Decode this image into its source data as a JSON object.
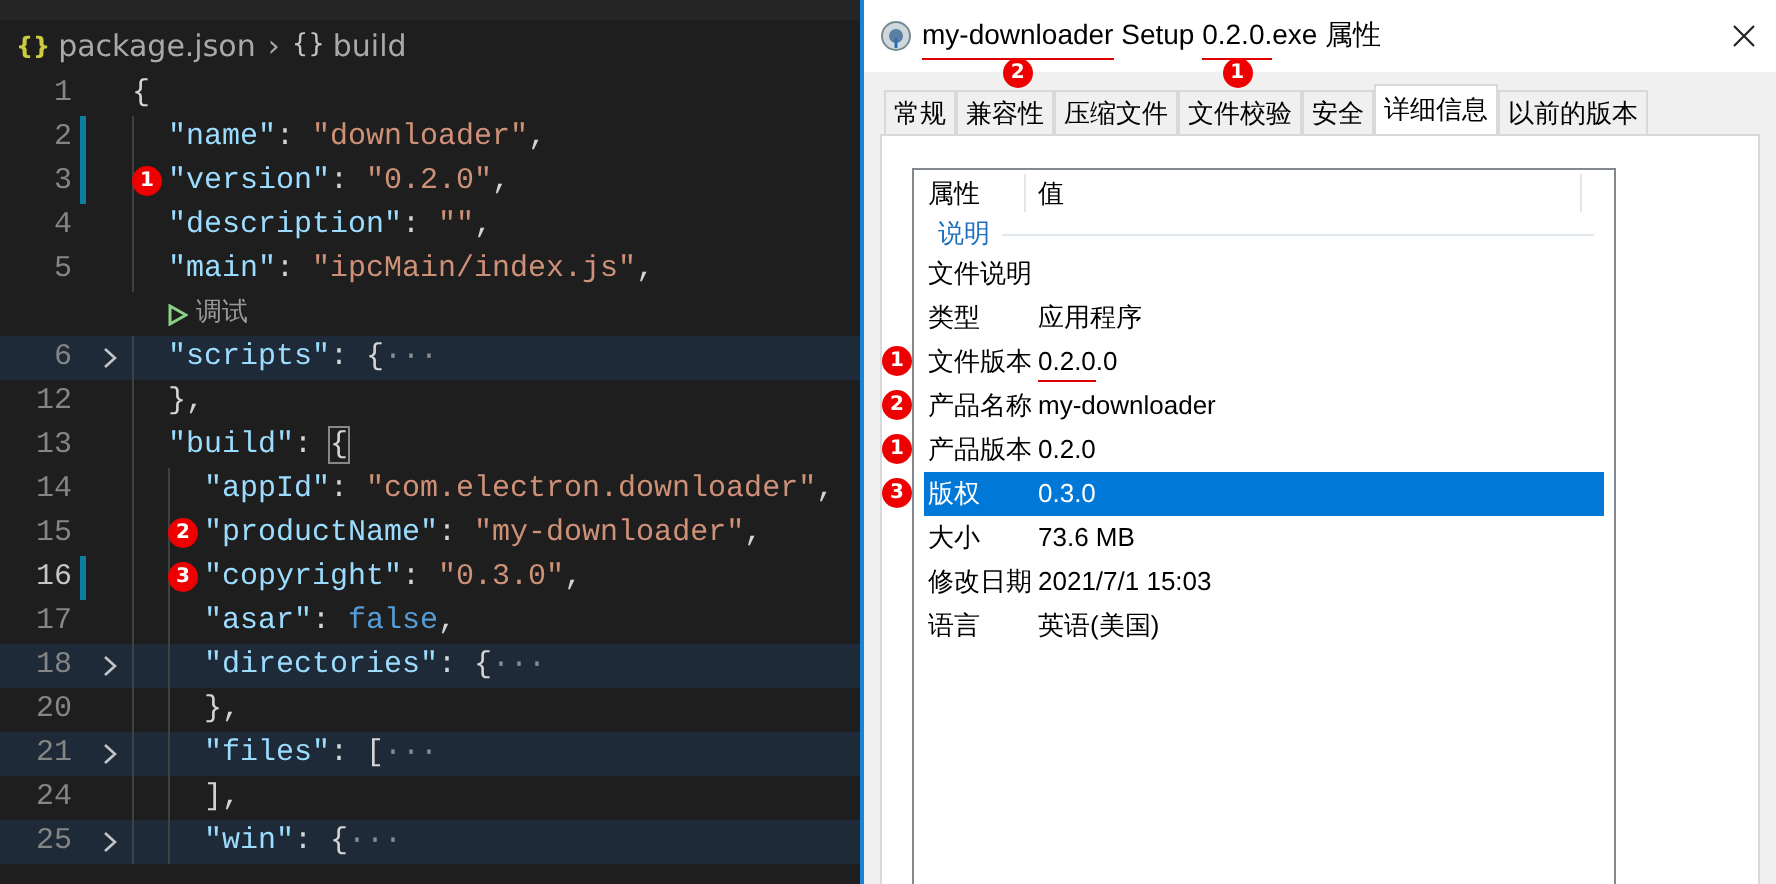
{
  "editor": {
    "breadcrumb": [
      {
        "kind": "file",
        "icon": "{}",
        "label": "package.json"
      },
      {
        "kind": "object",
        "separator": "›",
        "icon": "{}",
        "label": "build"
      }
    ],
    "lines": [
      {
        "kind": "code",
        "number": "1",
        "folded": false,
        "modified": false,
        "current": false,
        "tokens": [
          {
            "kind": "punc",
            "text": "{"
          }
        ],
        "children": [
          {
            "kind": "code",
            "number": "2",
            "folded": false,
            "modified": true,
            "current": false,
            "tokens": [
              {
                "kind": "key",
                "text": "\"name\""
              },
              {
                "kind": "punc",
                "text": ": "
              },
              {
                "kind": "str",
                "text": "\"downloader\""
              },
              {
                "kind": "punc",
                "text": ","
              }
            ]
          },
          {
            "kind": "code",
            "number": "3",
            "folded": false,
            "modified": true,
            "current": false,
            "badge": "1",
            "tokens": [
              {
                "kind": "key",
                "text": "\"version\""
              },
              {
                "kind": "punc",
                "text": ": "
              },
              {
                "kind": "str",
                "text": "\"0.2.0\""
              },
              {
                "kind": "punc",
                "text": ","
              }
            ]
          },
          {
            "kind": "code",
            "number": "4",
            "folded": false,
            "modified": false,
            "current": false,
            "tokens": [
              {
                "kind": "key",
                "text": "\"description\""
              },
              {
                "kind": "punc",
                "text": ": "
              },
              {
                "kind": "str",
                "text": "\"\""
              },
              {
                "kind": "punc",
                "text": ","
              }
            ]
          },
          {
            "kind": "code",
            "number": "5",
            "folded": false,
            "modified": false,
            "current": false,
            "tokens": [
              {
                "kind": "key",
                "text": "\"main\""
              },
              {
                "kind": "punc",
                "text": ": "
              },
              {
                "kind": "str",
                "text": "\"ipcMain/index.js\""
              },
              {
                "kind": "punc",
                "text": ","
              }
            ]
          },
          {
            "kind": "lens",
            "label": "调试"
          },
          {
            "kind": "code",
            "number": "6",
            "folded": true,
            "modified": false,
            "current": false,
            "tokens": [
              {
                "kind": "key",
                "text": "\"scripts\""
              },
              {
                "kind": "punc",
                "text": ": {"
              },
              {
                "kind": "fold",
                "text": "···"
              }
            ]
          },
          {
            "kind": "code",
            "number": "12",
            "folded": false,
            "modified": false,
            "current": false,
            "tokens": [
              {
                "kind": "punc",
                "text": "},"
              }
            ]
          },
          {
            "kind": "code",
            "number": "13",
            "folded": false,
            "modified": false,
            "current": false,
            "tokens": [
              {
                "kind": "key",
                "text": "\"build\""
              },
              {
                "kind": "punc",
                "text": ": "
              },
              {
                "kind": "bracket",
                "text": "{"
              }
            ],
            "children": [
              {
                "kind": "code",
                "number": "14",
                "folded": false,
                "modified": false,
                "current": false,
                "tokens": [
                  {
                    "kind": "key",
                    "text": "\"appId\""
                  },
                  {
                    "kind": "punc",
                    "text": ": "
                  },
                  {
                    "kind": "str",
                    "text": "\"com.electron.downloader\""
                  },
                  {
                    "kind": "punc",
                    "text": ","
                  }
                ]
              },
              {
                "kind": "code",
                "number": "15",
                "folded": false,
                "modified": false,
                "current": false,
                "badge": "2",
                "tokens": [
                  {
                    "kind": "key",
                    "text": "\"productName\""
                  },
                  {
                    "kind": "punc",
                    "text": ": "
                  },
                  {
                    "kind": "str",
                    "text": "\"my-downloader\""
                  },
                  {
                    "kind": "punc",
                    "text": ","
                  }
                ]
              },
              {
                "kind": "code",
                "number": "16",
                "folded": false,
                "modified": true,
                "current": true,
                "badge": "3",
                "tokens": [
                  {
                    "kind": "key",
                    "text": "\"copyright\""
                  },
                  {
                    "kind": "punc",
                    "text": ": "
                  },
                  {
                    "kind": "str",
                    "text": "\"0.3.0\""
                  },
                  {
                    "kind": "punc",
                    "text": ","
                  }
                ]
              },
              {
                "kind": "code",
                "number": "17",
                "folded": false,
                "modified": false,
                "current": false,
                "tokens": [
                  {
                    "kind": "key",
                    "text": "\"asar\""
                  },
                  {
                    "kind": "punc",
                    "text": ": "
                  },
                  {
                    "kind": "kw",
                    "text": "false"
                  },
                  {
                    "kind": "punc",
                    "text": ","
                  }
                ]
              },
              {
                "kind": "code",
                "number": "18",
                "folded": true,
                "modified": false,
                "current": false,
                "tokens": [
                  {
                    "kind": "key",
                    "text": "\"directories\""
                  },
                  {
                    "kind": "punc",
                    "text": ": {"
                  },
                  {
                    "kind": "fold",
                    "text": "···"
                  }
                ]
              },
              {
                "kind": "code",
                "number": "20",
                "folded": false,
                "modified": false,
                "current": false,
                "tokens": [
                  {
                    "kind": "punc",
                    "text": "},"
                  }
                ]
              },
              {
                "kind": "code",
                "number": "21",
                "folded": true,
                "modified": false,
                "current": false,
                "tokens": [
                  {
                    "kind": "key",
                    "text": "\"files\""
                  },
                  {
                    "kind": "punc",
                    "text": ": ["
                  },
                  {
                    "kind": "fold",
                    "text": "···"
                  }
                ]
              },
              {
                "kind": "code",
                "number": "24",
                "folded": false,
                "modified": false,
                "current": false,
                "tokens": [
                  {
                    "kind": "punc",
                    "text": "],"
                  }
                ]
              },
              {
                "kind": "code",
                "number": "25",
                "folded": true,
                "modified": false,
                "current": false,
                "tokens": [
                  {
                    "kind": "key",
                    "text": "\"win\""
                  },
                  {
                    "kind": "punc",
                    "text": ": {"
                  },
                  {
                    "kind": "fold",
                    "text": "···"
                  }
                ]
              }
            ]
          }
        ]
      }
    ]
  },
  "dialog": {
    "title": [
      {
        "text": "my-downloader",
        "underline": true,
        "badge": "2"
      },
      {
        "text": " Setup ",
        "underline": false
      },
      {
        "text": "0.2.0.",
        "underline": true,
        "badge": "1"
      },
      {
        "text": "exe 属性",
        "underline": false
      }
    ],
    "tabs": [
      {
        "label": "常规",
        "selected": false
      },
      {
        "label": "兼容性",
        "selected": false
      },
      {
        "label": "压缩文件",
        "selected": false
      },
      {
        "label": "文件校验",
        "selected": false
      },
      {
        "label": "安全",
        "selected": false
      },
      {
        "label": "详细信息",
        "selected": true
      },
      {
        "label": "以前的版本",
        "selected": false
      }
    ],
    "columns": [
      "属性",
      "值"
    ],
    "group": "说明",
    "rows": [
      {
        "property": "文件说明",
        "value": [],
        "selected": false
      },
      {
        "property": "类型",
        "value": [
          {
            "text": "应用程序",
            "underline": false
          }
        ],
        "selected": false
      },
      {
        "property": "文件版本",
        "badge": "1",
        "value": [
          {
            "text": "0.2.0",
            "underline": true
          },
          {
            "text": ".0",
            "underline": false
          }
        ],
        "selected": false
      },
      {
        "property": "产品名称",
        "badge": "2",
        "value": [
          {
            "text": "my-downloader",
            "underline": false
          }
        ],
        "selected": false
      },
      {
        "property": "产品版本",
        "badge": "1",
        "value": [
          {
            "text": "0.2.0",
            "underline": false
          }
        ],
        "selected": false
      },
      {
        "property": "版权",
        "badge": "3",
        "value": [
          {
            "text": "0.3.0",
            "underline": false
          }
        ],
        "selected": true
      },
      {
        "property": "大小",
        "value": [
          {
            "text": "73.6 MB",
            "underline": false
          }
        ],
        "selected": false
      },
      {
        "property": "修改日期",
        "value": [
          {
            "text": "2021/7/1 15:03",
            "underline": false
          }
        ],
        "selected": false
      },
      {
        "property": "语言",
        "value": [
          {
            "text": "英语(美国)",
            "underline": false
          }
        ],
        "selected": false
      }
    ]
  }
}
